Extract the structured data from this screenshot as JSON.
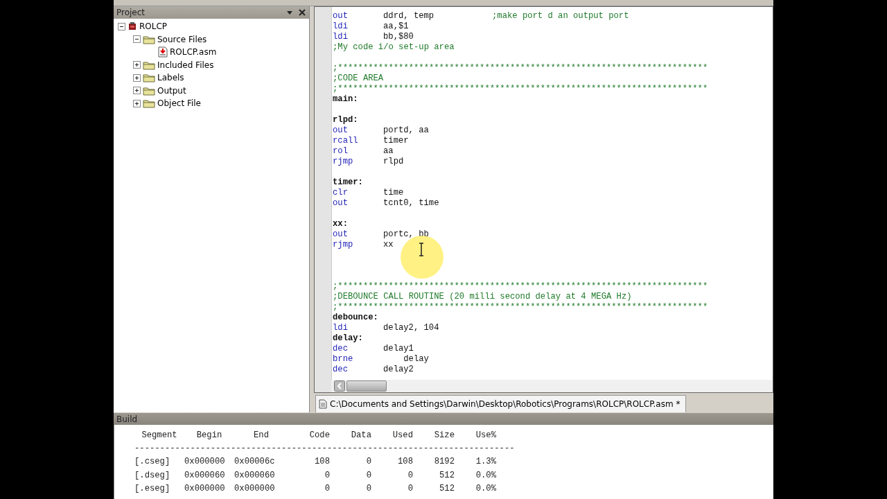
{
  "project_panel": {
    "title": "Project",
    "tree": [
      {
        "label": "ROLCP",
        "kind": "project",
        "expanded": true,
        "children": [
          {
            "label": "Source Files",
            "kind": "folder",
            "expanded": true,
            "children": [
              {
                "label": "ROLCP.asm",
                "kind": "file"
              }
            ]
          },
          {
            "label": "Included Files",
            "kind": "folder",
            "expanded": false
          },
          {
            "label": "Labels",
            "kind": "folder",
            "expanded": false
          },
          {
            "label": "Output",
            "kind": "folder",
            "expanded": false
          },
          {
            "label": "Object File",
            "kind": "folder",
            "expanded": false
          }
        ]
      }
    ]
  },
  "editor": {
    "lines": [
      {
        "kind": "instr",
        "op": "out",
        "args": "ddrd, temp",
        "comment": ";make port d an output port"
      },
      {
        "kind": "instr",
        "op": "ldi",
        "args": "aa,$1"
      },
      {
        "kind": "instr",
        "op": "ldi",
        "args": "bb,$80"
      },
      {
        "kind": "comment",
        "text": ";My code i/o set-up area"
      },
      {
        "kind": "blank"
      },
      {
        "kind": "comment",
        "text": ";*************************************************************************"
      },
      {
        "kind": "comment",
        "text": ";CODE AREA"
      },
      {
        "kind": "comment",
        "text": ";*************************************************************************"
      },
      {
        "kind": "label",
        "text": "main:"
      },
      {
        "kind": "blank"
      },
      {
        "kind": "label",
        "text": "rlpd:"
      },
      {
        "kind": "instr",
        "op": "out",
        "args": "portd, aa"
      },
      {
        "kind": "instr",
        "op": "rcall",
        "args": "timer"
      },
      {
        "kind": "instr",
        "op": "rol",
        "args": "aa"
      },
      {
        "kind": "instr",
        "op": "rjmp",
        "args": "rlpd"
      },
      {
        "kind": "blank"
      },
      {
        "kind": "label",
        "text": "timer:"
      },
      {
        "kind": "instr",
        "op": "clr",
        "args": "time"
      },
      {
        "kind": "instr",
        "op": "out",
        "args": "tcnt0, time"
      },
      {
        "kind": "blank"
      },
      {
        "kind": "label",
        "text": "xx:"
      },
      {
        "kind": "instr",
        "op": "out",
        "args": "portc, bb"
      },
      {
        "kind": "instr",
        "op": "rjmp",
        "args": "xx"
      },
      {
        "kind": "blank"
      },
      {
        "kind": "blank"
      },
      {
        "kind": "blank"
      },
      {
        "kind": "comment",
        "text": ";*************************************************************************"
      },
      {
        "kind": "comment",
        "text": ";DEBOUNCE CALL ROUTINE (20 milli second delay at 4 MEGA Hz)"
      },
      {
        "kind": "comment",
        "text": ";*************************************************************************"
      },
      {
        "kind": "label",
        "text": "debounce:"
      },
      {
        "kind": "instr",
        "op": "ldi",
        "args": "delay2, 104"
      },
      {
        "kind": "label",
        "text": "delay:"
      },
      {
        "kind": "instr",
        "op": "dec",
        "args": "delay1"
      },
      {
        "kind": "instr",
        "op": "brne",
        "args": "    delay"
      },
      {
        "kind": "instr",
        "op": "dec",
        "args": "delay2"
      }
    ],
    "tab": {
      "label": "C:\\Documents and Settings\\Darwin\\Desktop\\Robotics\\Programs\\ROLCP\\ROLCP.asm *"
    }
  },
  "build_panel": {
    "title": "Build",
    "columns": [
      "Segment",
      "Begin",
      "End",
      "Code",
      "Data",
      "Used",
      "Size",
      "Use%"
    ],
    "separator": "---------------------------------------------------------------------------",
    "rows": [
      [
        "[.cseg]",
        "0x000000",
        "0x00006c",
        "108",
        "0",
        "108",
        "8192",
        "1.3%"
      ],
      [
        "[.dseg]",
        "0x000060",
        "0x000060",
        "0",
        "0",
        "0",
        "512",
        "0.0%"
      ],
      [
        "[.eseg]",
        "0x000000",
        "0x000000",
        "0",
        "0",
        "0",
        "512",
        "0.0%"
      ]
    ]
  }
}
